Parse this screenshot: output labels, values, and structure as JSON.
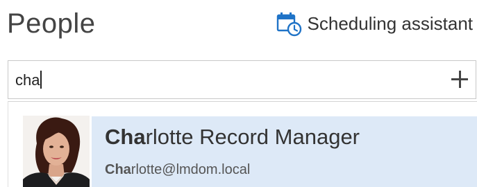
{
  "header": {
    "title": "People",
    "scheduling_label": "Scheduling assistant",
    "scheduling_icon": "calendar-clock-icon",
    "accent_color": "#1f73c7"
  },
  "search": {
    "value": "cha",
    "add_icon": "plus-icon"
  },
  "suggestions": [
    {
      "name_match": "Cha",
      "name_rest": "rlotte Record Manager",
      "email_match": "Cha",
      "email_rest": "rlotte@lmdom.local",
      "highlight_color": "#dde9f7"
    }
  ]
}
